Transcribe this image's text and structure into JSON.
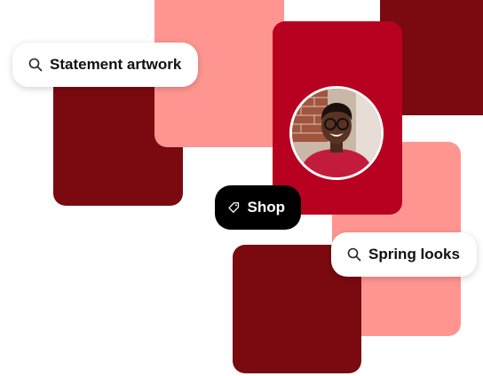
{
  "colors": {
    "dark_red": "#7a0a10",
    "salmon": "#ff9591",
    "red": "#b80020",
    "pill_dark": "#000000",
    "pill_light": "#ffffff"
  },
  "search_pills": [
    {
      "text": "Statement artwork",
      "icon": "search-icon"
    },
    {
      "text": "Spring looks",
      "icon": "search-icon"
    }
  ],
  "shop_pill": {
    "text": "Shop",
    "icon": "tag-icon"
  },
  "avatar": {
    "icon": "person-photo"
  }
}
